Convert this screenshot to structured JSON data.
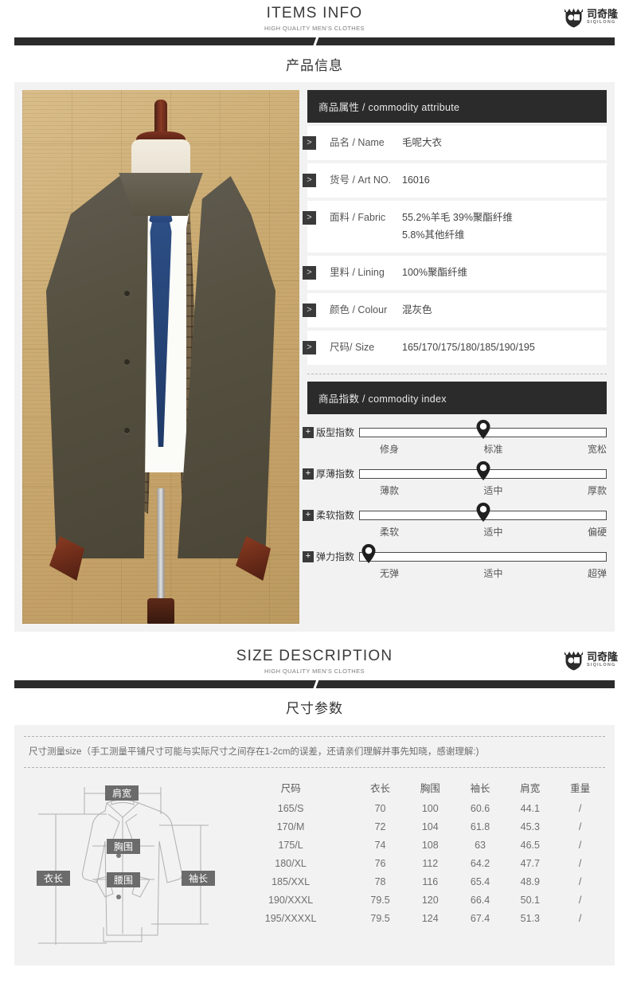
{
  "brand": {
    "cn": "司奇隆",
    "en": "SIQILONG",
    "logo_icon": "shield-crown-logo"
  },
  "header1": {
    "title": "ITEMS INFO",
    "subtitle": "HIGH QUALITY MEN'S CLOTHES",
    "section": "产品信息"
  },
  "header2": {
    "title": "SIZE DESCRIPTION",
    "subtitle": "HIGH QUALITY MEN'S CLOTHES",
    "section": "尺寸参数"
  },
  "photo": {
    "alt": "毛呢大衣 product photo on mannequin"
  },
  "attributes": {
    "heading": "商品属性 / commodity attribute",
    "chevron_icon": "chevron-right-icon",
    "rows": [
      {
        "label": "品名 / Name",
        "value": [
          "毛呢大衣"
        ]
      },
      {
        "label": "货号 / Art NO.",
        "value": [
          "16016"
        ]
      },
      {
        "label": "面料 / Fabric",
        "value": [
          "55.2%羊毛   39%聚酯纤维",
          "5.8%其他纤维"
        ]
      },
      {
        "label": "里料 / Lining",
        "value": [
          "100%聚酯纤维"
        ]
      },
      {
        "label": "颜色 / Colour",
        "value": [
          "混灰色"
        ]
      },
      {
        "label": "尺码/ Size",
        "value": [
          "165/170/175/180/185/190/195"
        ]
      }
    ]
  },
  "index": {
    "heading": "商品指数 / commodity index",
    "plus_icon": "plus-icon",
    "marker_icon": "map-pin-marker",
    "rows": [
      {
        "label": "版型指数",
        "position": 50,
        "scale": [
          "修身",
          "标准",
          "宽松"
        ]
      },
      {
        "label": "厚薄指数",
        "position": 50,
        "scale": [
          "薄款",
          "适中",
          "厚款"
        ]
      },
      {
        "label": "柔软指数",
        "position": 50,
        "scale": [
          "柔软",
          "适中",
          "偏硬"
        ]
      },
      {
        "label": "弹力指数",
        "position": 4,
        "scale": [
          "无弹",
          "适中",
          "超弹"
        ]
      }
    ]
  },
  "size": {
    "note": "尺寸测量size（手工测量平铺尺寸可能与实际尺寸之间存在1-2cm的误差，还请亲们理解并事先知晓，感谢理解:)",
    "diagram_labels": {
      "shoulder": "肩宽",
      "chest": "胸围",
      "waist": "腰围",
      "length": "衣长",
      "sleeve": "袖长"
    },
    "columns": [
      "尺码",
      "衣长",
      "胸围",
      "袖长",
      "肩宽",
      "重量"
    ],
    "rows": [
      [
        "165/S",
        "70",
        "100",
        "60.6",
        "44.1",
        "/"
      ],
      [
        "170/M",
        "72",
        "104",
        "61.8",
        "45.3",
        "/"
      ],
      [
        "175/L",
        "74",
        "108",
        "63",
        "46.5",
        "/"
      ],
      [
        "180/XL",
        "76",
        "112",
        "64.2",
        "47.7",
        "/"
      ],
      [
        "185/XXL",
        "78",
        "116",
        "65.4",
        "48.9",
        "/"
      ],
      [
        "190/XXXL",
        "79.5",
        "120",
        "66.4",
        "50.1",
        "/"
      ],
      [
        "195/XXXXL",
        "79.5",
        "124",
        "67.4",
        "51.3",
        "/"
      ]
    ]
  },
  "colors": {
    "dark": "#2b2b2b",
    "panel": "#f2f2f2",
    "text": "#4a4a4a"
  }
}
